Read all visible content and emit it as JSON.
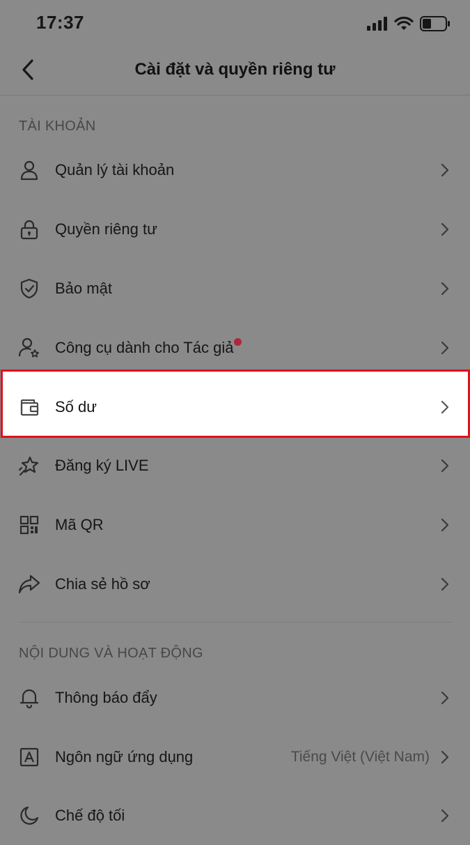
{
  "status_bar": {
    "time": "17:37",
    "icons": [
      "cellular-signal-icon",
      "wifi-icon",
      "battery-icon"
    ]
  },
  "header": {
    "title": "Cài đặt và quyền riêng tư",
    "back_icon": "back-arrow-icon"
  },
  "sections": [
    {
      "title": "TÀI KHOẢN",
      "items": [
        {
          "label": "Quản lý tài khoản",
          "icon": "person-icon"
        },
        {
          "label": "Quyền riêng tư",
          "icon": "lock-icon"
        },
        {
          "label": "Bảo mật",
          "icon": "shield-check-icon"
        },
        {
          "label": "Công cụ dành cho Tác giả",
          "icon": "creator-person-star-icon",
          "badge": "red-dot"
        },
        {
          "label": "Số dư",
          "icon": "wallet-icon",
          "highlighted": true
        },
        {
          "label": "Đăng ký LIVE",
          "icon": "star-live-icon"
        },
        {
          "label": "Mã QR",
          "icon": "qr-code-icon"
        },
        {
          "label": "Chia sẻ hồ sơ",
          "icon": "share-arrow-icon"
        }
      ]
    },
    {
      "title": "NỘI DUNG VÀ HOẠT ĐỘNG",
      "items": [
        {
          "label": "Thông báo đẩy",
          "icon": "bell-icon"
        },
        {
          "label": "Ngôn ngữ ứng dụng",
          "icon": "language-a-icon",
          "value": "Tiếng Việt (Việt Nam)"
        },
        {
          "label": "Chế độ tối",
          "icon": "moon-icon"
        }
      ]
    }
  ],
  "colors": {
    "overlay_background": "#8a8a8a",
    "highlight_border": "#e0101c",
    "badge_dot": "#b0263a"
  }
}
